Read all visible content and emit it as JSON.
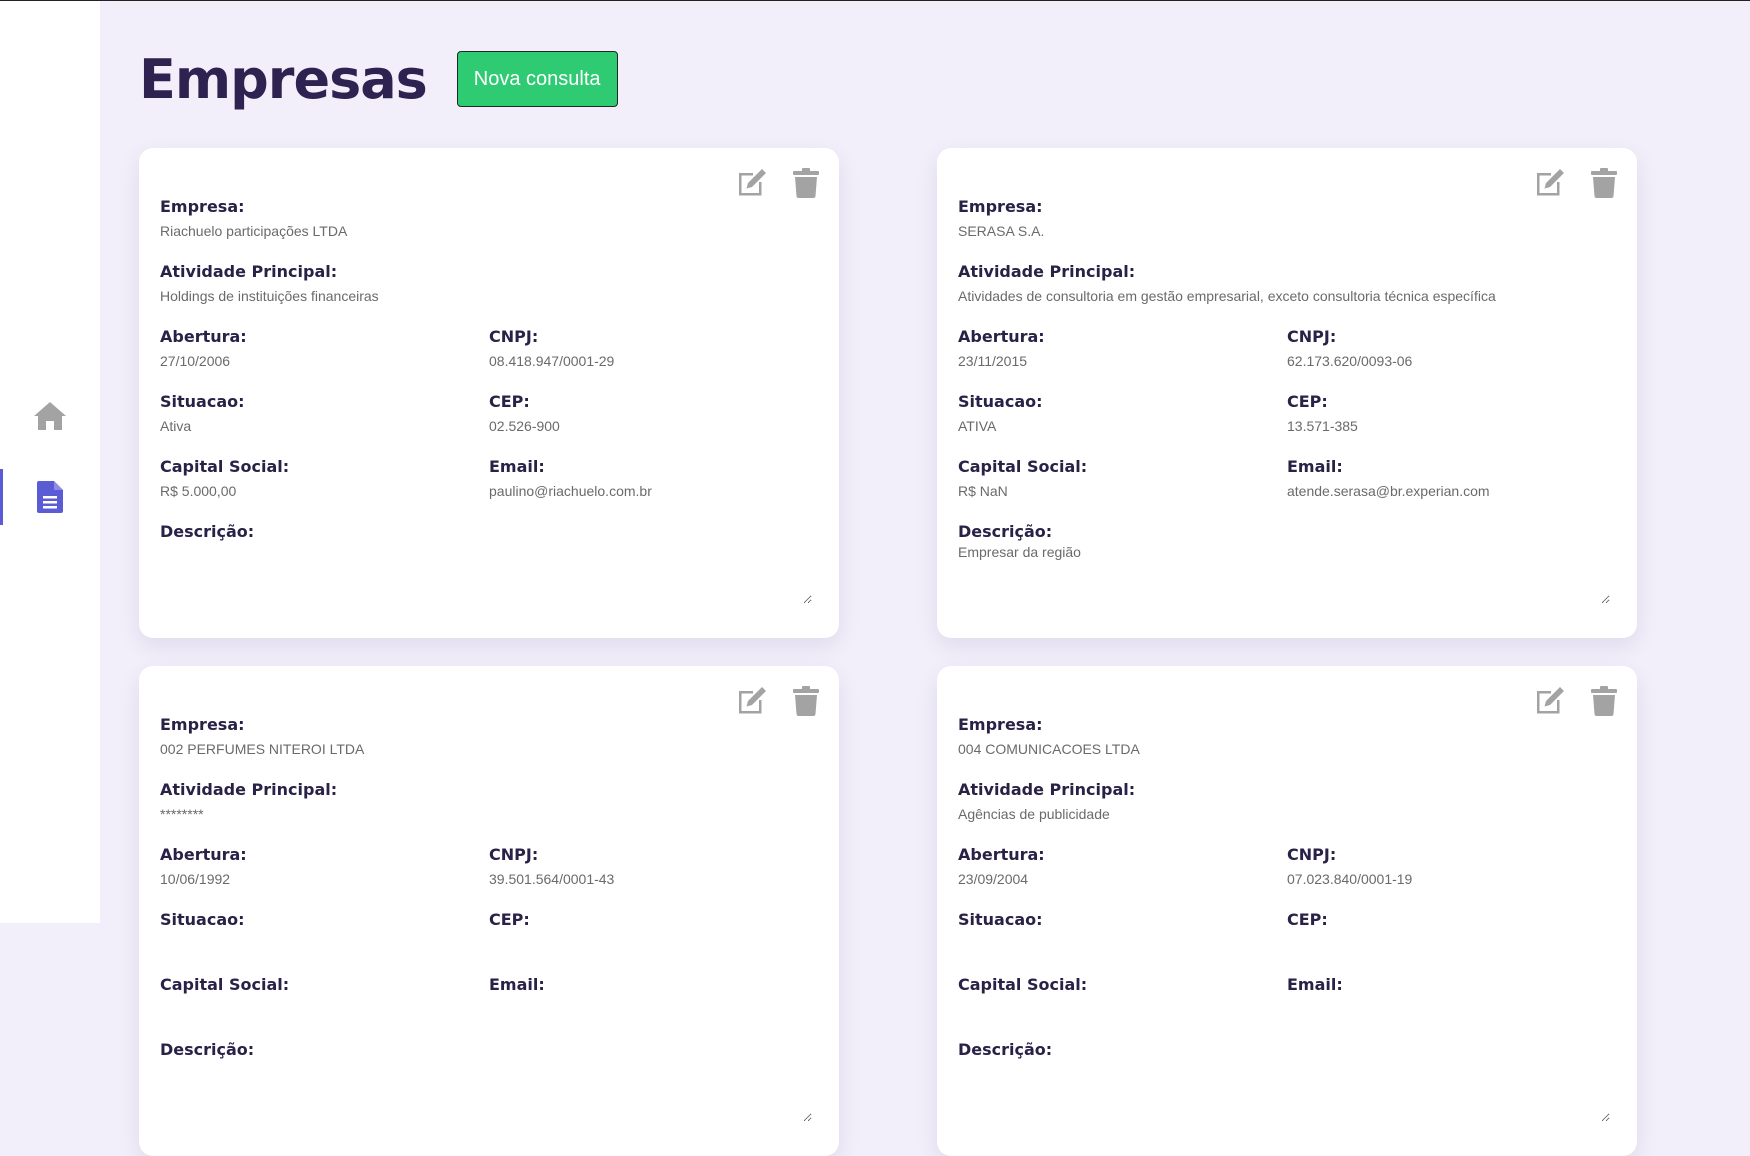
{
  "page": {
    "title": "Empresas",
    "new_button": "Nova consulta"
  },
  "sidebar": {
    "items": [
      {
        "icon": "home-icon"
      },
      {
        "icon": "document-icon"
      }
    ]
  },
  "labels": {
    "empresa": "Empresa:",
    "atividade": "Atividade Principal:",
    "abertura": "Abertura:",
    "cnpj": "CNPJ:",
    "situacao": "Situacao:",
    "cep": "CEP:",
    "capital": "Capital Social:",
    "email": "Email:",
    "descricao": "Descrição:"
  },
  "companies": [
    {
      "empresa": "Riachuelo participações LTDA",
      "atividade": "Holdings de instituições financeiras",
      "abertura": "27/10/2006",
      "cnpj": "08.418.947/0001-29",
      "situacao": "Ativa",
      "cep": "02.526-900",
      "capital": "R$ 5.000,00",
      "email": "paulino@riachuelo.com.br",
      "descricao": ""
    },
    {
      "empresa": "SERASA S.A.",
      "atividade": "Atividades de consultoria em gestão empresarial, exceto consultoria técnica específica",
      "abertura": "23/11/2015",
      "cnpj": "62.173.620/0093-06",
      "situacao": "ATIVA",
      "cep": "13.571-385",
      "capital": "R$ NaN",
      "email": "atende.serasa@br.experian.com",
      "descricao": "Empresar da região"
    },
    {
      "empresa": "002 PERFUMES NITEROI LTDA",
      "atividade": "********",
      "abertura": "10/06/1992",
      "cnpj": "39.501.564/0001-43",
      "situacao": "",
      "cep": "",
      "capital": "",
      "email": "",
      "descricao": ""
    },
    {
      "empresa": "004 COMUNICACOES LTDA",
      "atividade": "Agências de publicidade",
      "abertura": "23/09/2004",
      "cnpj": "07.023.840/0001-19",
      "situacao": "",
      "cep": "",
      "capital": "",
      "email": "",
      "descricao": ""
    }
  ],
  "colors": {
    "accent": "#5b5bd6",
    "button": "#2fcb72",
    "title": "#2e2350",
    "background": "#f2effa"
  }
}
